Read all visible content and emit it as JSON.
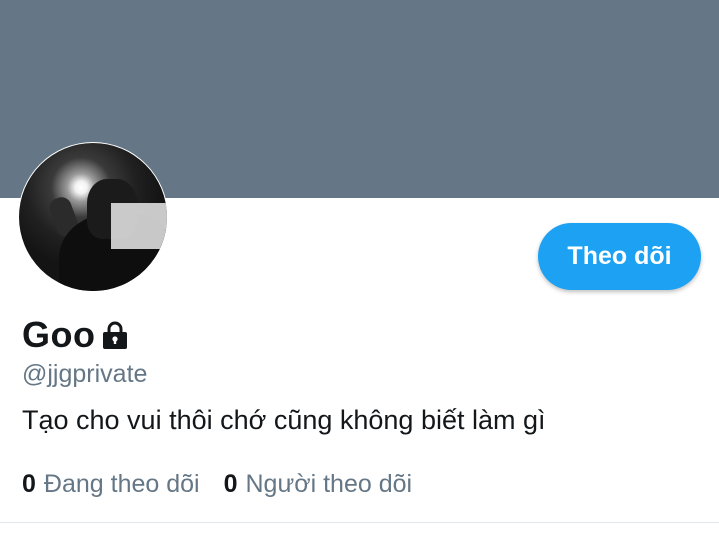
{
  "profile": {
    "display_name": "Goo",
    "handle": "@jjgprivate",
    "bio": "Tạo cho vui thôi chớ cũng không biết làm gì",
    "protected_icon": "lock-icon",
    "avatar": "profile-photo"
  },
  "actions": {
    "follow_label": "Theo dõi"
  },
  "stats": {
    "following_count": "0",
    "following_label": "Đang theo dõi",
    "followers_count": "0",
    "followers_label": "Người theo dõi"
  },
  "colors": {
    "banner": "#657786",
    "accent": "#1da1f2",
    "text_primary": "#14171a",
    "text_secondary": "#657786"
  }
}
